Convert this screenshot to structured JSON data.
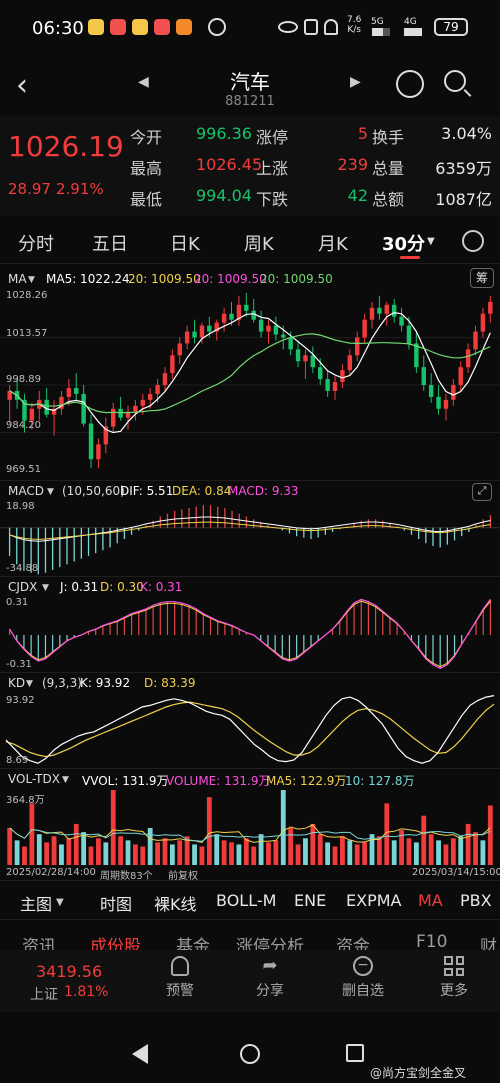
{
  "status_bar": {
    "time": "06:30",
    "net_speed_top": "7.6",
    "net_speed_unit": "K/s",
    "signal_5g": "5G",
    "signal_4g": "4G",
    "battery": "79"
  },
  "header": {
    "title": "汽车",
    "code": "881211"
  },
  "quote": {
    "price": "1026.19",
    "change": "28.97",
    "change_pct": "2.91%",
    "rows": [
      {
        "label1": "今开",
        "value1": "996.36",
        "label2": "涨停",
        "value2": "5",
        "label3": "换手",
        "value3": "3.04%"
      },
      {
        "label1": "最高",
        "value1": "1026.45",
        "label2": "上涨",
        "value2": "239",
        "label3": "总量",
        "value3": "6359万"
      },
      {
        "label1": "最低",
        "value1": "994.04",
        "label2": "下跌",
        "value2": "42",
        "label3": "总额",
        "value3": "1087亿"
      }
    ]
  },
  "period_tabs": [
    "分时",
    "五日",
    "日K",
    "周K",
    "月K",
    "30分"
  ],
  "main_chart": {
    "indicator": "MA",
    "ma5": "MA5: 1022.24",
    "ma20a": "20: 1009.50",
    "ma20b": "20: 1009.50",
    "ma20c": "20: 1009.50",
    "chip_label": "筹",
    "y_labels": [
      "1028.26",
      "1013.57",
      "998.89",
      "984.20",
      "969.51"
    ]
  },
  "macd": {
    "name": "MACD",
    "params": "(10,50,60)",
    "dif": "DIF: 5.51",
    "dea": "DEA: 0.84",
    "macd": "MACD: 9.33",
    "y_top": "18.98",
    "y_bottom": "-34.88"
  },
  "cjdx": {
    "name": "CJDX",
    "j": "J: 0.31",
    "d": "D: 0.30",
    "k": "K: 0.31",
    "y_top": "0.31",
    "y_bottom": "-0.31"
  },
  "kd": {
    "name": "KD",
    "params": "(9,3,3)",
    "k": "K: 93.92",
    "d": "D: 83.39",
    "y_top": "93.92",
    "y_bottom": "8.69"
  },
  "vol": {
    "name": "VOL-TDX",
    "vvol": "VVOL: 131.9万",
    "volume": "VOLUME: 131.9万",
    "ma5": "MA5: 122.9万",
    "ma10": "10: 127.8万",
    "y_top": "364.8万",
    "date_left": "2025/02/28/14:00",
    "period_count": "周期数83个",
    "restore": "前复权",
    "date_right": "2025/03/14/15:00"
  },
  "indicator_bar": [
    "主图",
    "时图",
    "裸K线",
    "BOLL-M",
    "ENE",
    "EXPMA",
    "MA",
    "PBX"
  ],
  "bottom_tabs": [
    "资讯",
    "成份股",
    "基金",
    "涨停分析",
    "资金",
    "F10",
    "财"
  ],
  "dock": {
    "index_value": "3419.56",
    "index_name": "上证",
    "index_pct": "1.81%",
    "items": [
      "预警",
      "分享",
      "删自选",
      "更多"
    ]
  },
  "watermark": "@尚方宝剑全金叉",
  "colors": {
    "up": "#f23c3c",
    "down": "#17c26a",
    "ma5": "#ffffff",
    "ma20": "#f0d24a",
    "ma20b": "#ff4fe0",
    "ma20c": "#6fd86f",
    "macd_pos": "#e04848",
    "macd_neg": "#7ad6d6"
  },
  "icons": [
    "wechat-icon",
    "back-icon",
    "prev-arrow-icon",
    "next-arrow-icon",
    "mascot-icon",
    "search-icon",
    "settings-icon",
    "bell-icon",
    "share-icon",
    "remove-icon",
    "grid-icon",
    "nav-back-icon",
    "nav-home-icon",
    "nav-recent-icon"
  ],
  "series": {
    "candles": [
      [
        993,
        998,
        985,
        996
      ],
      [
        996,
        1000,
        990,
        993
      ],
      [
        993,
        995,
        982,
        986
      ],
      [
        986,
        992,
        983,
        990
      ],
      [
        990,
        996,
        986,
        993
      ],
      [
        993,
        997,
        987,
        988
      ],
      [
        988,
        993,
        981,
        990
      ],
      [
        990,
        996,
        988,
        994
      ],
      [
        994,
        1000,
        991,
        997
      ],
      [
        997,
        1002,
        993,
        995
      ],
      [
        995,
        998,
        984,
        985
      ],
      [
        985,
        988,
        970,
        973
      ],
      [
        973,
        980,
        970,
        978
      ],
      [
        978,
        987,
        975,
        984
      ],
      [
        984,
        992,
        982,
        990
      ],
      [
        990,
        994,
        986,
        987
      ],
      [
        987,
        991,
        983,
        989
      ],
      [
        989,
        993,
        986,
        991
      ],
      [
        991,
        995,
        988,
        993
      ],
      [
        993,
        997,
        990,
        995
      ],
      [
        995,
        1000,
        992,
        998
      ],
      [
        998,
        1004,
        996,
        1002
      ],
      [
        1002,
        1010,
        1000,
        1008
      ],
      [
        1008,
        1014,
        1005,
        1012
      ],
      [
        1012,
        1018,
        1010,
        1016
      ],
      [
        1016,
        1020,
        1012,
        1014
      ],
      [
        1014,
        1019,
        1012,
        1018
      ],
      [
        1018,
        1021,
        1014,
        1016
      ],
      [
        1016,
        1020,
        1013,
        1019
      ],
      [
        1019,
        1024,
        1016,
        1022
      ],
      [
        1022,
        1026,
        1018,
        1020
      ],
      [
        1020,
        1028,
        1018,
        1025
      ],
      [
        1025,
        1029,
        1021,
        1023
      ],
      [
        1023,
        1027,
        1019,
        1020
      ],
      [
        1020,
        1023,
        1014,
        1016
      ],
      [
        1016,
        1020,
        1012,
        1018
      ],
      [
        1018,
        1021,
        1013,
        1015
      ],
      [
        1015,
        1018,
        1010,
        1014
      ],
      [
        1014,
        1016,
        1008,
        1010
      ],
      [
        1010,
        1013,
        1004,
        1006
      ],
      [
        1006,
        1010,
        1000,
        1008
      ],
      [
        1008,
        1011,
        1002,
        1004
      ],
      [
        1004,
        1007,
        998,
        1000
      ],
      [
        1000,
        1003,
        994,
        996
      ],
      [
        996,
        1001,
        993,
        999
      ],
      [
        999,
        1005,
        997,
        1003
      ],
      [
        1003,
        1010,
        1001,
        1008
      ],
      [
        1008,
        1016,
        1006,
        1014
      ],
      [
        1014,
        1022,
        1012,
        1020
      ],
      [
        1020,
        1026,
        1017,
        1024
      ],
      [
        1024,
        1028,
        1020,
        1022
      ],
      [
        1022,
        1026,
        1018,
        1025
      ],
      [
        1025,
        1027,
        1019,
        1021
      ],
      [
        1021,
        1024,
        1016,
        1018
      ],
      [
        1018,
        1021,
        1010,
        1012
      ],
      [
        1012,
        1016,
        1002,
        1004
      ],
      [
        1004,
        1008,
        996,
        998
      ],
      [
        998,
        1002,
        992,
        994
      ],
      [
        994,
        998,
        988,
        990
      ],
      [
        990,
        995,
        986,
        993
      ],
      [
        993,
        1000,
        991,
        998
      ],
      [
        998,
        1006,
        996,
        1004
      ],
      [
        1004,
        1012,
        1002,
        1010
      ],
      [
        1010,
        1018,
        1008,
        1016
      ],
      [
        1016,
        1024,
        1014,
        1022
      ],
      [
        1022,
        1028,
        1019,
        1026
      ]
    ],
    "macd": [
      -20,
      -26,
      -30,
      -32,
      -33,
      -32,
      -30,
      -28,
      -26,
      -24,
      -22,
      -20,
      -18,
      -16,
      -14,
      -11,
      -8,
      -5,
      -2,
      2,
      5,
      8,
      10,
      12,
      13,
      14,
      15,
      16,
      16,
      15,
      14,
      12,
      10,
      8,
      6,
      4,
      2,
      0,
      -2,
      -4,
      -6,
      -7,
      -8,
      -7,
      -5,
      -3,
      -1,
      1,
      3,
      5,
      6,
      6,
      5,
      3,
      1,
      -2,
      -5,
      -8,
      -11,
      -13,
      -14,
      -12,
      -9,
      -6,
      -3,
      2,
      6,
      9
    ],
    "cjdx": [
      0.05,
      -0.05,
      -0.12,
      -0.18,
      -0.22,
      -0.2,
      -0.15,
      -0.1,
      -0.05,
      -0.02,
      0.0,
      0.03,
      0.05,
      0.08,
      0.1,
      0.12,
      0.15,
      0.18,
      0.2,
      0.22,
      0.25,
      0.27,
      0.28,
      0.28,
      0.27,
      0.25,
      0.22,
      0.18,
      0.15,
      0.12,
      0.1,
      0.08,
      0.05,
      0.02,
      0.0,
      -0.05,
      -0.1,
      -0.15,
      -0.2,
      -0.22,
      -0.2,
      -0.15,
      -0.1,
      -0.05,
      0.0,
      0.05,
      0.12,
      0.2,
      0.27,
      0.3,
      0.28,
      0.25,
      0.2,
      0.15,
      0.1,
      0.03,
      -0.05,
      -0.12,
      -0.2,
      -0.25,
      -0.28,
      -0.25,
      -0.18,
      -0.08,
      0.02,
      0.12,
      0.22,
      0.3
    ],
    "kd_k": [
      40,
      30,
      20,
      15,
      12,
      18,
      28,
      35,
      40,
      45,
      48,
      50,
      55,
      60,
      65,
      70,
      75,
      80,
      82,
      85,
      88,
      90,
      88,
      85,
      80,
      75,
      72,
      70,
      65,
      55,
      45,
      35,
      28,
      20,
      15,
      14,
      16,
      25,
      40,
      55,
      70,
      82,
      90,
      92,
      88,
      80,
      70,
      60,
      45,
      30,
      20,
      15,
      12,
      15,
      25,
      40,
      55,
      70,
      82,
      88,
      92,
      93.9
    ],
    "kd_d": [
      38,
      35,
      30,
      25,
      22,
      20,
      22,
      26,
      30,
      35,
      40,
      44,
      48,
      52,
      56,
      60,
      64,
      68,
      72,
      76,
      80,
      83,
      85,
      86,
      84,
      82,
      80,
      78,
      74,
      68,
      60,
      52,
      45,
      38,
      32,
      26,
      22,
      22,
      25,
      32,
      42,
      52,
      62,
      70,
      76,
      78,
      76,
      72,
      66,
      58,
      50,
      42,
      35,
      28,
      24,
      25,
      32,
      42,
      54,
      66,
      76,
      83.4
    ],
    "vol": [
      180,
      120,
      90,
      300,
      150,
      110,
      140,
      100,
      130,
      200,
      160,
      90,
      130,
      110,
      365,
      140,
      120,
      100,
      90,
      180,
      110,
      130,
      100,
      120,
      140,
      100,
      90,
      330,
      150,
      120,
      110,
      100,
      130,
      90,
      150,
      110,
      120,
      365,
      180,
      100,
      130,
      200,
      150,
      110,
      90,
      140,
      120,
      100,
      110,
      150,
      140,
      300,
      120,
      170,
      130,
      110,
      240,
      150,
      120,
      100,
      130,
      140,
      200,
      160,
      120,
      290
    ]
  }
}
